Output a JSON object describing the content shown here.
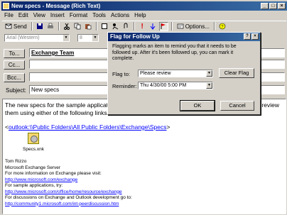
{
  "window": {
    "title": "New specs - Message (Rich Text)"
  },
  "menu": [
    "File",
    "Edit",
    "View",
    "Insert",
    "Format",
    "Tools",
    "Actions",
    "Help"
  ],
  "toolbar": {
    "send_label": "Send",
    "options_label": "Options..."
  },
  "format": {
    "font": "Arial (Western)",
    "size": "8"
  },
  "headers": {
    "to_label": "To...",
    "to_value": "Exchange Team",
    "cc_label": "Cc...",
    "cc_value": "",
    "bcc_label": "Bcc...",
    "bcc_value": "",
    "subject_label": "Subject:",
    "subject_value": "New specs"
  },
  "body": {
    "intro_left": "The new specs for the sample application",
    "intro_right": "n review",
    "intro_line2": "them using either of the following links:",
    "link_prefix": "<",
    "link1": "outlook:\\\\Public Folders\\All Public Folders\\Exchange\\Specs",
    "link_suffix": ">",
    "attachment_name": "Specs.xnk",
    "sig_name": "Tom Rizzo",
    "sig_company": "Microsoft Exchange Server",
    "info_line": "For more information on Exchange please visit:",
    "link2": "http://www.microsoft.com/exchange",
    "sample_line": "For sample applications, try:",
    "link3": "http://www.microsoft.com/office/home/resource/exchange",
    "discuss_line": "For discussions on Exchange and Outlook development go to:",
    "link4": "http://community1.microsoft.com/int-peerdiscussion.htm"
  },
  "dialog": {
    "title": "Flag for Follow Up",
    "message": "Flagging marks an item to remind you that it needs to be followed up. After it's been followed up, you can mark it complete.",
    "flag_to_label": "Flag to:",
    "flag_to_value": "Please review",
    "clear_flag_label": "Clear Flag",
    "reminder_label": "Reminder:",
    "reminder_value": "Thu 4/30/00 5:00 PM",
    "ok_label": "OK",
    "cancel_label": "Cancel"
  },
  "colors": {
    "titlebar": "#0a246a",
    "link": "#0000ff",
    "face": "#d4d0c8"
  }
}
